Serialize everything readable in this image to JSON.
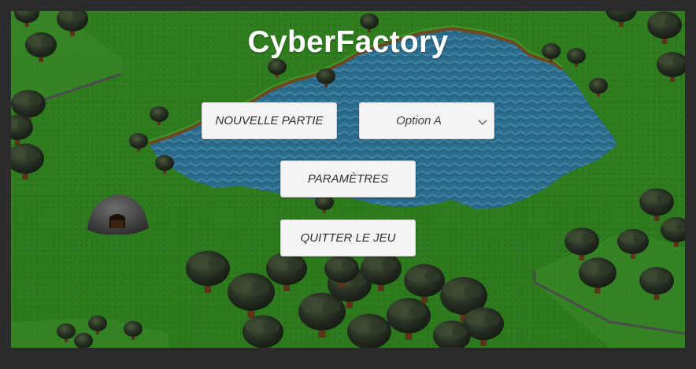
{
  "app": {
    "title": "CyberFactory"
  },
  "menu": {
    "new_game_label": "NOUVELLE PARTIE",
    "mode_select": {
      "selected": "Option A",
      "icon": "chevron-down-icon"
    },
    "settings_label": "PARAMÈTRES",
    "quit_label": "QUITTER LE JEU"
  },
  "colors": {
    "grass": "#2e7c1e",
    "water": "#2f6f8f",
    "tree_canopy": "#1f2a1c",
    "button_bg": "#f4f4f4",
    "title": "#ffffff"
  }
}
